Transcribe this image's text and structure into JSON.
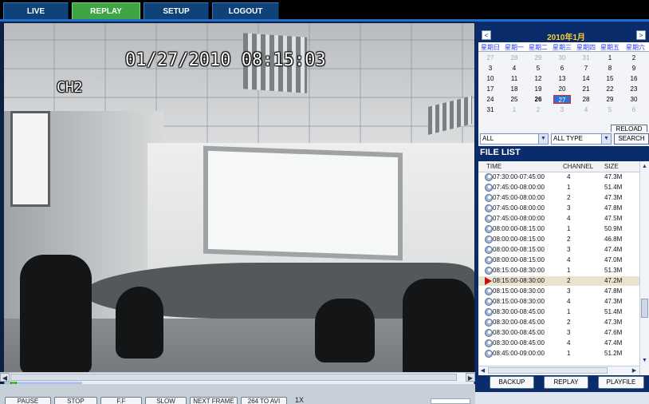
{
  "nav": {
    "tabs": [
      {
        "label": "LIVE",
        "active": false
      },
      {
        "label": "REPLAY",
        "active": true
      },
      {
        "label": "SETUP",
        "active": false
      },
      {
        "label": "LOGOUT",
        "active": false
      }
    ],
    "active_color": "#3fa544",
    "tab_color": "#10427a"
  },
  "video": {
    "timestamp": "01/27/2010 08:15:03",
    "channel_label": "CH2",
    "playback_progress": 0.012
  },
  "controls": {
    "buttons": [
      "PAUSE",
      "STOP",
      "F.F",
      "SLOW",
      "NEXT FRAME",
      "264 TO AVI"
    ],
    "speed": "1X"
  },
  "calendar": {
    "title": "2010年1月",
    "prev_icon": "<",
    "next_icon": ">",
    "weekdays": [
      "星期日",
      "星期一",
      "星期二",
      "星期三",
      "星期四",
      "星期五",
      "星期六"
    ],
    "weeks": [
      [
        {
          "d": "27",
          "m": true
        },
        {
          "d": "28",
          "m": true
        },
        {
          "d": "29",
          "m": true
        },
        {
          "d": "30",
          "m": true
        },
        {
          "d": "31",
          "m": true
        },
        {
          "d": "1"
        },
        {
          "d": "2"
        }
      ],
      [
        {
          "d": "3"
        },
        {
          "d": "4"
        },
        {
          "d": "5"
        },
        {
          "d": "6"
        },
        {
          "d": "7"
        },
        {
          "d": "8"
        },
        {
          "d": "9"
        }
      ],
      [
        {
          "d": "10"
        },
        {
          "d": "11"
        },
        {
          "d": "12"
        },
        {
          "d": "13"
        },
        {
          "d": "14"
        },
        {
          "d": "15"
        },
        {
          "d": "16"
        }
      ],
      [
        {
          "d": "17"
        },
        {
          "d": "18"
        },
        {
          "d": "19"
        },
        {
          "d": "20"
        },
        {
          "d": "21"
        },
        {
          "d": "22"
        },
        {
          "d": "23"
        }
      ],
      [
        {
          "d": "24"
        },
        {
          "d": "25"
        },
        {
          "d": "26",
          "b": true
        },
        {
          "d": "27",
          "sel": true
        },
        {
          "d": "28"
        },
        {
          "d": "29"
        },
        {
          "d": "30"
        }
      ],
      [
        {
          "d": "31"
        },
        {
          "d": "1",
          "m": true
        },
        {
          "d": "2",
          "m": true
        },
        {
          "d": "3",
          "m": true
        },
        {
          "d": "4",
          "m": true
        },
        {
          "d": "5",
          "m": true
        },
        {
          "d": "6",
          "m": true
        }
      ]
    ],
    "reload_label": "RELOAD"
  },
  "filters": {
    "channel_value": "ALL",
    "type_value": "ALL TYPE",
    "search_label": "SEARCH"
  },
  "file_list": {
    "title": "FILE LIST",
    "headers": {
      "time": "TIME",
      "channel": "CHANNEL",
      "size": "SIZE"
    },
    "rows": [
      {
        "time": "07:30:00-07:45:00",
        "channel": "4",
        "size": "47.3M"
      },
      {
        "time": "07:45:00-08:00:00",
        "channel": "1",
        "size": "51.4M"
      },
      {
        "time": "07:45:00-08:00:00",
        "channel": "2",
        "size": "47.3M"
      },
      {
        "time": "07:45:00-08:00:00",
        "channel": "3",
        "size": "47.8M"
      },
      {
        "time": "07:45:00-08:00:00",
        "channel": "4",
        "size": "47.5M"
      },
      {
        "time": "08:00:00-08:15:00",
        "channel": "1",
        "size": "50.9M"
      },
      {
        "time": "08:00:00-08:15:00",
        "channel": "2",
        "size": "46.8M"
      },
      {
        "time": "08:00:00-08:15:00",
        "channel": "3",
        "size": "47.4M"
      },
      {
        "time": "08:00:00-08:15:00",
        "channel": "4",
        "size": "47.0M"
      },
      {
        "time": "08:15:00-08:30:00",
        "channel": "1",
        "size": "51.3M"
      },
      {
        "time": "08:15:00-08:30:00",
        "channel": "2",
        "size": "47.2M",
        "playing": true
      },
      {
        "time": "08:15:00-08:30:00",
        "channel": "3",
        "size": "47.8M"
      },
      {
        "time": "08:15:00-08:30:00",
        "channel": "4",
        "size": "47.3M"
      },
      {
        "time": "08:30:00-08:45:00",
        "channel": "1",
        "size": "51.4M"
      },
      {
        "time": "08:30:00-08:45:00",
        "channel": "2",
        "size": "47.3M"
      },
      {
        "time": "08:30:00-08:45:00",
        "channel": "3",
        "size": "47.6M"
      },
      {
        "time": "08:30:00-08:45:00",
        "channel": "4",
        "size": "47.4M"
      },
      {
        "time": "08:45:00-09:00:00",
        "channel": "1",
        "size": "51.2M"
      }
    ],
    "buttons": [
      "BACKUP",
      "REPLAY",
      "PLAYFILE"
    ]
  }
}
